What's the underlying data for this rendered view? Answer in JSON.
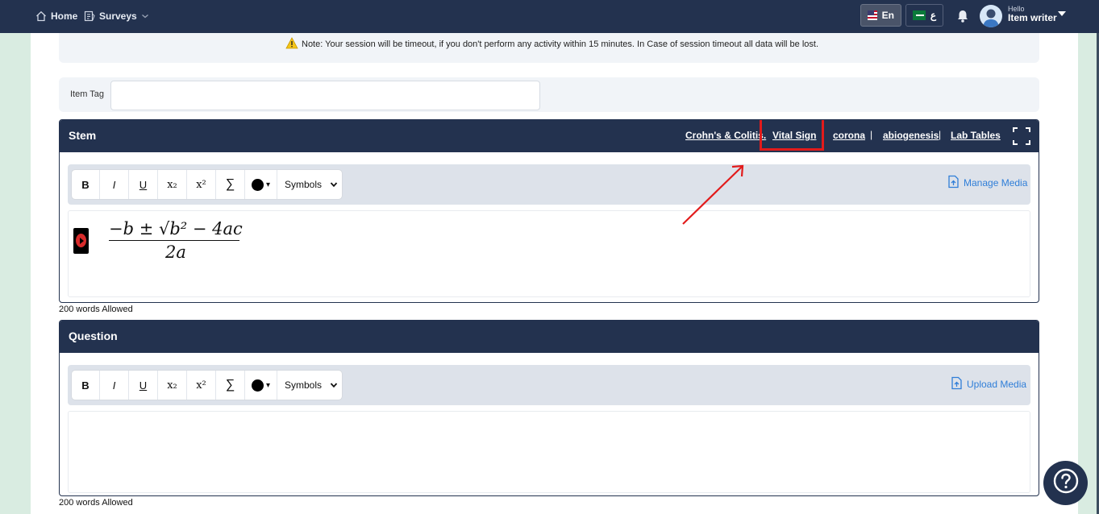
{
  "nav": {
    "home_label": "Home",
    "surveys_label": "Surveys"
  },
  "lang": {
    "en_label": "En",
    "ar_label": "ع"
  },
  "user": {
    "hello": "Hello",
    "name": "Item writer"
  },
  "note": {
    "text": "Note: Your session will be timeout, if you don't perform any activity within 15 minutes. In Case of session timeout all data will be lost."
  },
  "item_tag": {
    "label": "Item Tag",
    "value": ""
  },
  "stem": {
    "title": "Stem",
    "links": [
      "Crohn's & Colitis.",
      "Vital Sign",
      "corona",
      "abiogenesis",
      "Lab Tables"
    ],
    "media_label": "Manage Media",
    "formula_numerator": "−b ± √b² − 4ac",
    "formula_denominator": "2a",
    "words_allowed": "200 words Allowed"
  },
  "question": {
    "title": "Question",
    "media_label": "Upload Media",
    "words_allowed": "200 words Allowed"
  },
  "toolbar": {
    "bold": "B",
    "italic": "I",
    "underline": "U",
    "subscript": "x₂",
    "superscript": "x²",
    "sum": "∑",
    "color_caret": "▾",
    "symbols": "Symbols"
  },
  "colors": {
    "nav_bg": "#23324f",
    "accent_link": "#2f7ed8",
    "highlight": "#e21b1b"
  }
}
